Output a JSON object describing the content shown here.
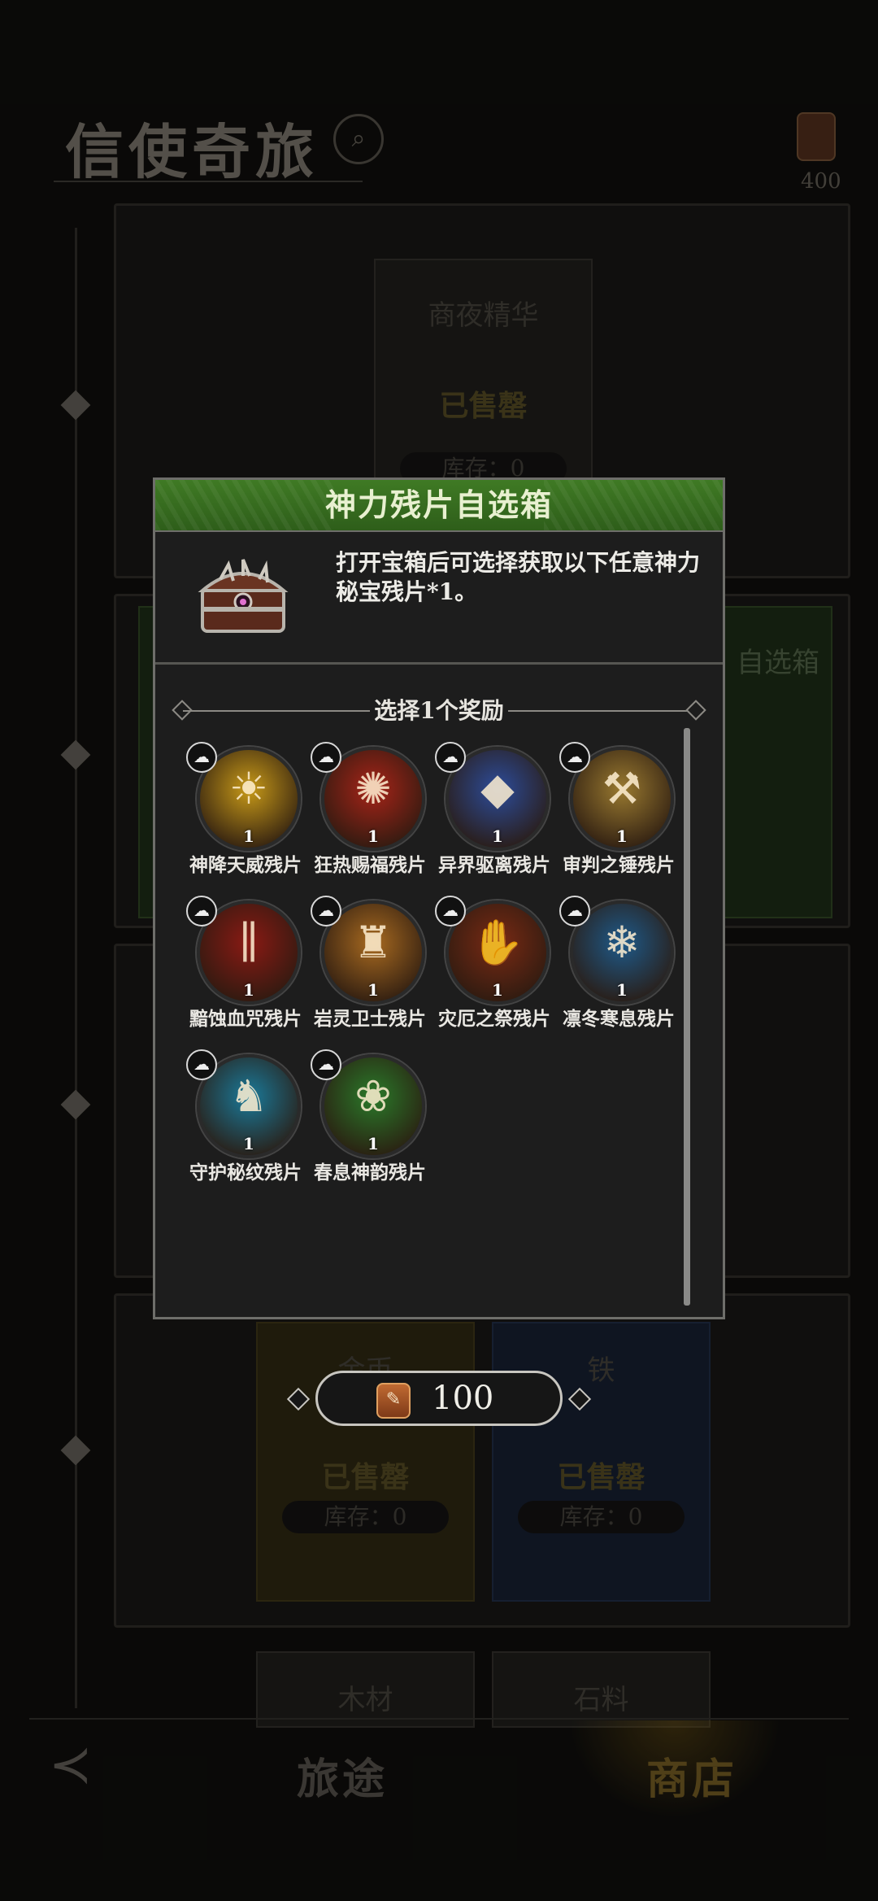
{
  "background": {
    "title": "信使奇旅",
    "currency_value": "400",
    "cards": [
      {
        "label": "商夜精华"
      },
      {
        "label": "已售罄"
      },
      {
        "label": "库存：0"
      },
      {
        "label": "自选箱"
      },
      {
        "label": "金币"
      },
      {
        "label": "铁"
      },
      {
        "label": "已售罄"
      },
      {
        "label": "已售罄"
      },
      {
        "label": "库存：0"
      },
      {
        "label": "库存：0"
      },
      {
        "label": "木材"
      },
      {
        "label": "石料"
      }
    ],
    "nav": {
      "journey": "旅途",
      "shop": "商店"
    }
  },
  "modal": {
    "title": "神力残片自选箱",
    "description": "打开宝箱后可选择获取以下任意神力秘宝残片*1。",
    "section_title": "选择1个奖励",
    "items": [
      {
        "name": "神降天威残片",
        "count": "1",
        "color": "#c89a18",
        "glyph": "☀",
        "icon": "divine-might-icon"
      },
      {
        "name": "狂热赐福残片",
        "count": "1",
        "color": "#a82418",
        "glyph": "✺",
        "icon": "fervor-blessing-icon"
      },
      {
        "name": "异界驱离残片",
        "count": "1",
        "color": "#2c4c9a",
        "glyph": "◆",
        "icon": "otherworld-banish-icon"
      },
      {
        "name": "审判之锤残片",
        "count": "1",
        "color": "#9a7a30",
        "glyph": "⚒",
        "icon": "judgment-hammer-icon"
      },
      {
        "name": "黯蚀血咒残片",
        "count": "1",
        "color": "#8a1a14",
        "glyph": "∥",
        "icon": "blood-curse-icon"
      },
      {
        "name": "岩灵卫士残片",
        "count": "1",
        "color": "#a86a20",
        "glyph": "♜",
        "icon": "rock-guardian-icon"
      },
      {
        "name": "灾厄之祭残片",
        "count": "1",
        "color": "#7a2a14",
        "glyph": "✋",
        "icon": "calamity-rite-icon"
      },
      {
        "name": "凛冬寒息残片",
        "count": "1",
        "color": "#1e5a8a",
        "glyph": "❄",
        "icon": "winter-breath-icon"
      },
      {
        "name": "守护秘纹残片",
        "count": "1",
        "color": "#1a7a9a",
        "glyph": "♞",
        "icon": "guardian-rune-icon"
      },
      {
        "name": "春息神韵残片",
        "count": "1",
        "color": "#2a7a2a",
        "glyph": "❀",
        "icon": "spring-breath-icon"
      }
    ],
    "price": "100"
  }
}
